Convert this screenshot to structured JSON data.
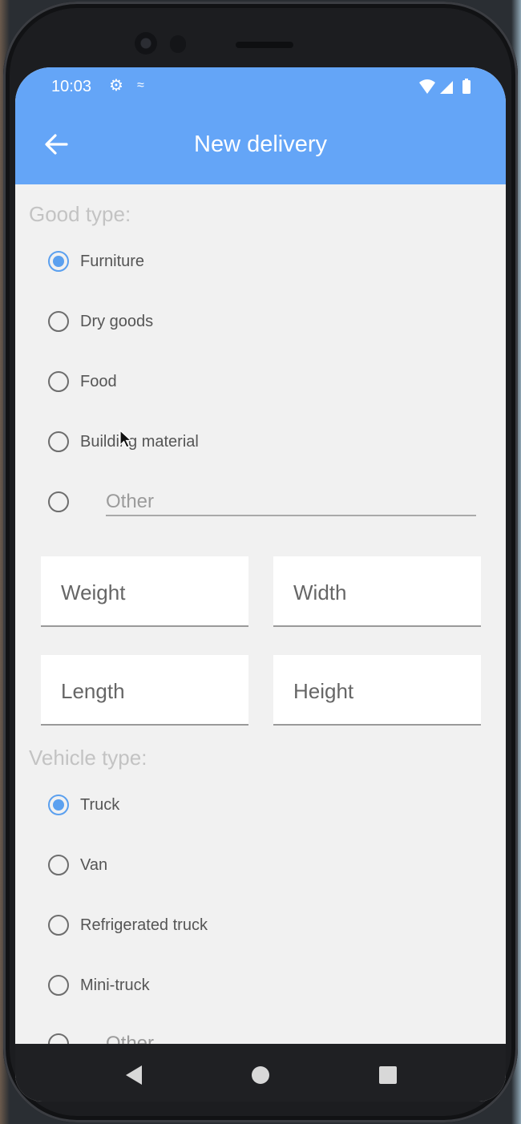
{
  "status_bar": {
    "time": "10:03",
    "icons": [
      "gear-icon",
      "sync-icon",
      "wifi-icon",
      "signal-icon",
      "battery-icon"
    ]
  },
  "app_bar": {
    "title": "New delivery",
    "back_icon": "arrow-left-icon"
  },
  "good_type": {
    "label": "Good type:",
    "options": [
      {
        "label": "Furniture",
        "checked": true
      },
      {
        "label": "Dry goods",
        "checked": false
      },
      {
        "label": "Food",
        "checked": false
      },
      {
        "label": "Building material",
        "checked": false
      }
    ],
    "other_placeholder": "Other"
  },
  "dimensions": {
    "weight": "Weight",
    "width": "Width",
    "length": "Length",
    "height": "Height"
  },
  "vehicle_type": {
    "label": "Vehicle type:",
    "options": [
      {
        "label": "Truck",
        "checked": true
      },
      {
        "label": "Van",
        "checked": false
      },
      {
        "label": "Refrigerated truck",
        "checked": false
      },
      {
        "label": "Mini-truck",
        "checked": false
      }
    ],
    "other_placeholder": "Other"
  },
  "colors": {
    "primary": "#64a5f7",
    "accent": "#5ba0ef",
    "background": "#f1f1f1"
  }
}
